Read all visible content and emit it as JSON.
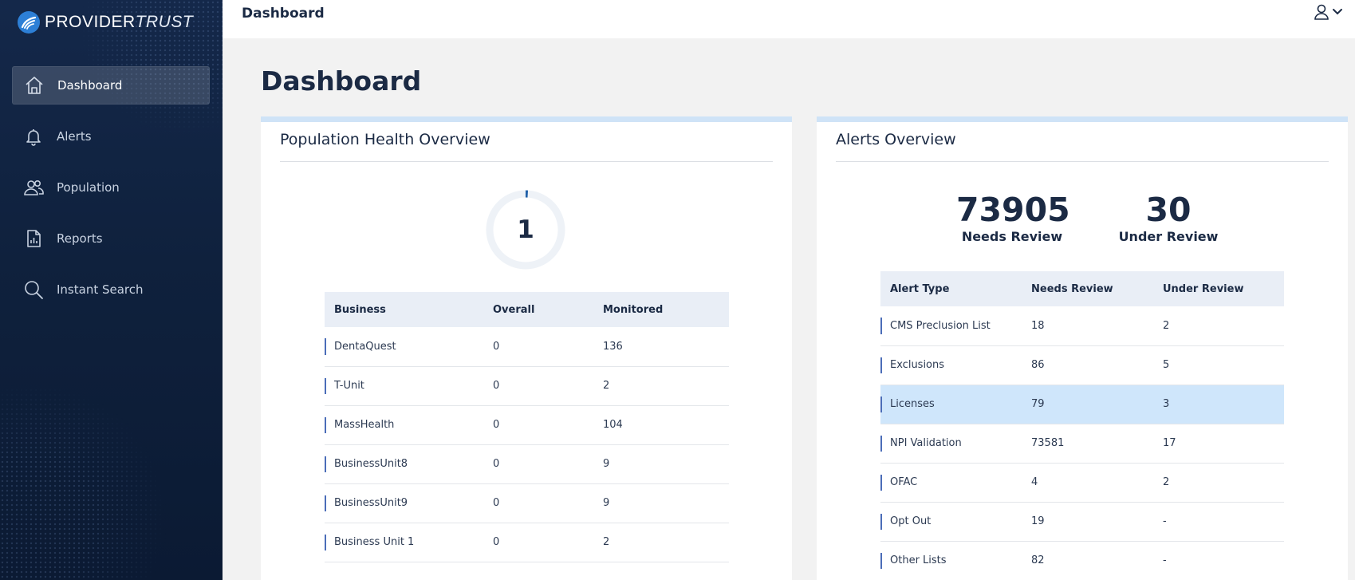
{
  "brand": {
    "name_part1": "PROVIDER",
    "name_part2": "TRUST",
    "accent": "#2d7fd6"
  },
  "sidebar": {
    "items": [
      {
        "label": "Dashboard",
        "icon": "home-icon",
        "active": true
      },
      {
        "label": "Alerts",
        "icon": "bell-icon",
        "active": false
      },
      {
        "label": "Population",
        "icon": "users-icon",
        "active": false
      },
      {
        "label": "Reports",
        "icon": "report-icon",
        "active": false
      },
      {
        "label": "Instant Search",
        "icon": "search-icon",
        "active": false
      }
    ]
  },
  "header": {
    "title": "Dashboard",
    "user_icon": "user-icon",
    "menu_icon": "chevron-down-icon"
  },
  "page": {
    "title": "Dashboard"
  },
  "population": {
    "title": "Population Health Overview",
    "donut_value": "1",
    "donut_fraction": 0.01,
    "columns": [
      "Business",
      "Overall",
      "Monitored"
    ],
    "rows": [
      [
        "DentaQuest",
        "0",
        "136"
      ],
      [
        "T-Unit",
        "0",
        "2"
      ],
      [
        "MassHealth",
        "0",
        "104"
      ],
      [
        "BusinessUnit8",
        "0",
        "9"
      ],
      [
        "BusinessUnit9",
        "0",
        "9"
      ],
      [
        "Business Unit 1",
        "0",
        "2"
      ]
    ]
  },
  "alerts": {
    "title": "Alerts Overview",
    "needs_review_count": "73905",
    "needs_review_label": "Needs Review",
    "under_review_count": "30",
    "under_review_label": "Under Review",
    "columns": [
      "Alert Type",
      "Needs Review",
      "Under Review"
    ],
    "rows": [
      [
        "CMS Preclusion List",
        "18",
        "2"
      ],
      [
        "Exclusions",
        "86",
        "5"
      ],
      [
        "Licenses",
        "79",
        "3"
      ],
      [
        "NPI Validation",
        "73581",
        "17"
      ],
      [
        "OFAC",
        "4",
        "2"
      ],
      [
        "Opt Out",
        "19",
        "-"
      ],
      [
        "Other Lists",
        "82",
        "-"
      ]
    ],
    "highlighted_row": "Licenses",
    "highlight_color": "#cfe6fb"
  }
}
